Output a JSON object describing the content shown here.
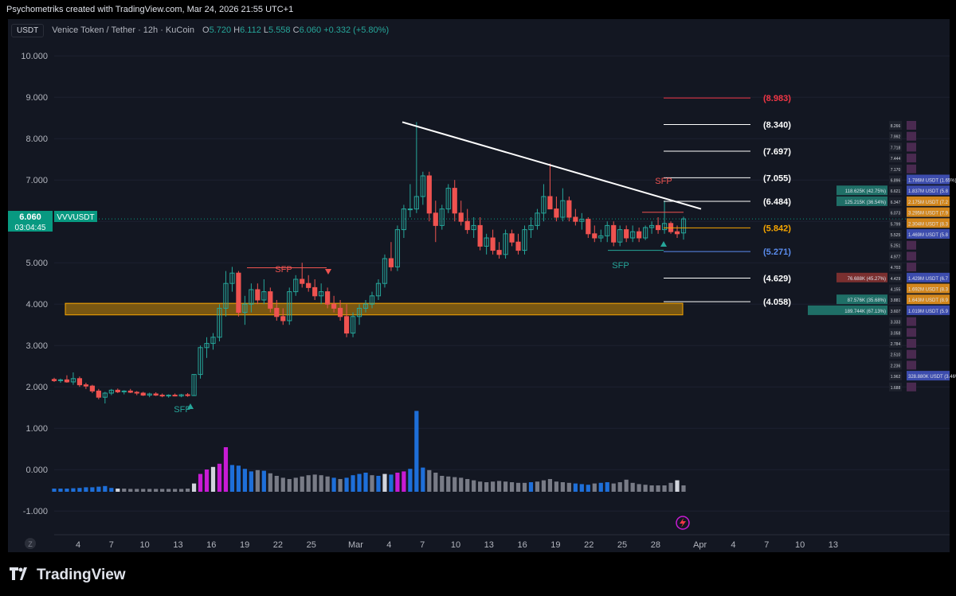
{
  "header": {
    "attribution": "Psychometriks created with TradingView.com, Mar 24, 2026 21:55 UTC+1"
  },
  "symbol": {
    "currency_button": "USDT",
    "title": "Venice Token / Tether · 12h · KuCoin",
    "o_label": "O",
    "o": "5.720",
    "h_label": "H",
    "h": "6.112",
    "l_label": "L",
    "l": "5.558",
    "c_label": "C",
    "c": "6.060",
    "change": "+0.332 (+5.80%)"
  },
  "price_tag": {
    "price": "6.060",
    "countdown": "03:04:45",
    "symbol_label": "VVVUSDT"
  },
  "footer": {
    "logo_text": "TradingView",
    "timezone_button": "Z"
  },
  "colors": {
    "up": "#26a69a",
    "down": "#ef5350",
    "accent": "#089981",
    "fib": "#ffffff",
    "fib_upper": "#f23645",
    "fib_mid": "#f7a600",
    "fib_low": "#5b8def",
    "zone": "#f7a600"
  },
  "chart_data": {
    "type": "candlestick",
    "title": "Venice Token / Tether · 12h · KuCoin",
    "ylim": [
      -1.0,
      10.0
    ],
    "y_ticks": [
      "10.000",
      "9.000",
      "8.000",
      "7.000",
      "6.000",
      "5.000",
      "4.000",
      "3.000",
      "2.000",
      "1.000",
      "0.000",
      "-1.000"
    ],
    "x_ticks": [
      {
        "label": "4",
        "day": 4
      },
      {
        "label": "7",
        "day": 7
      },
      {
        "label": "10",
        "day": 10
      },
      {
        "label": "13",
        "day": 13
      },
      {
        "label": "16",
        "day": 16
      },
      {
        "label": "19",
        "day": 19
      },
      {
        "label": "22",
        "day": 22
      },
      {
        "label": "25",
        "day": 25
      },
      {
        "label": "Mar",
        "day": 29
      },
      {
        "label": "4",
        "day": 32
      },
      {
        "label": "7",
        "day": 35
      },
      {
        "label": "10",
        "day": 38
      },
      {
        "label": "13",
        "day": 41
      },
      {
        "label": "16",
        "day": 44
      },
      {
        "label": "19",
        "day": 47
      },
      {
        "label": "22",
        "day": 50
      },
      {
        "label": "25",
        "day": 53
      },
      {
        "label": "28",
        "day": 56
      },
      {
        "label": "Apr",
        "day": 60
      },
      {
        "label": "4",
        "day": 63
      },
      {
        "label": "7",
        "day": 66
      },
      {
        "label": "10",
        "day": 69
      },
      {
        "label": "13",
        "day": 72
      }
    ],
    "candles": [
      [
        2.18,
        2.22,
        2.12,
        2.15
      ],
      [
        2.15,
        2.2,
        2.1,
        2.17
      ],
      [
        2.17,
        2.28,
        2.1,
        2.12
      ],
      [
        2.12,
        2.35,
        2.05,
        2.2
      ],
      [
        2.2,
        2.25,
        2.0,
        2.05
      ],
      [
        2.05,
        2.1,
        1.95,
        2.02
      ],
      [
        2.02,
        2.05,
        1.85,
        1.9
      ],
      [
        1.9,
        1.95,
        1.7,
        1.75
      ],
      [
        1.75,
        1.88,
        1.6,
        1.85
      ],
      [
        1.85,
        1.95,
        1.8,
        1.92
      ],
      [
        1.92,
        1.96,
        1.85,
        1.88
      ],
      [
        1.88,
        1.92,
        1.82,
        1.9
      ],
      [
        1.9,
        1.95,
        1.85,
        1.87
      ],
      [
        1.87,
        1.9,
        1.8,
        1.85
      ],
      [
        1.85,
        1.88,
        1.78,
        1.8
      ],
      [
        1.8,
        1.86,
        1.75,
        1.83
      ],
      [
        1.83,
        1.87,
        1.78,
        1.8
      ],
      [
        1.8,
        1.84,
        1.75,
        1.78
      ],
      [
        1.78,
        1.82,
        1.74,
        1.8
      ],
      [
        1.8,
        1.84,
        1.77,
        1.78
      ],
      [
        1.78,
        1.83,
        1.75,
        1.81
      ],
      [
        1.81,
        1.85,
        1.76,
        1.79
      ],
      [
        1.79,
        2.3,
        1.78,
        2.3
      ],
      [
        2.3,
        3.0,
        2.2,
        2.95
      ],
      [
        2.95,
        3.2,
        2.7,
        3.05
      ],
      [
        3.05,
        3.3,
        2.9,
        3.2
      ],
      [
        3.2,
        4.0,
        3.1,
        3.9
      ],
      [
        3.9,
        4.8,
        3.7,
        4.5
      ],
      [
        4.5,
        4.9,
        4.3,
        4.75
      ],
      [
        4.75,
        4.8,
        3.7,
        3.8
      ],
      [
        3.8,
        4.2,
        3.5,
        4.0
      ],
      [
        4.0,
        4.5,
        3.8,
        4.35
      ],
      [
        4.35,
        4.5,
        4.0,
        4.1
      ],
      [
        4.1,
        4.6,
        4.0,
        4.3
      ],
      [
        4.3,
        4.4,
        3.8,
        3.9
      ],
      [
        3.9,
        4.1,
        3.6,
        3.7
      ],
      [
        3.7,
        3.9,
        3.5,
        3.6
      ],
      [
        3.6,
        4.4,
        3.5,
        4.3
      ],
      [
        4.3,
        4.7,
        4.2,
        4.6
      ],
      [
        4.6,
        5.0,
        4.4,
        4.5
      ],
      [
        4.5,
        4.7,
        4.3,
        4.4
      ],
      [
        4.4,
        4.6,
        4.1,
        4.2
      ],
      [
        4.2,
        4.5,
        4.0,
        4.3
      ],
      [
        4.3,
        4.4,
        3.9,
        4.0
      ],
      [
        4.0,
        4.2,
        3.8,
        3.9
      ],
      [
        3.9,
        4.1,
        3.6,
        3.7
      ],
      [
        3.7,
        4.0,
        3.2,
        3.3
      ],
      [
        3.3,
        3.8,
        3.2,
        3.7
      ],
      [
        3.7,
        4.0,
        3.5,
        3.9
      ],
      [
        3.9,
        4.1,
        3.8,
        4.0
      ],
      [
        4.0,
        4.3,
        3.9,
        4.2
      ],
      [
        4.2,
        4.6,
        4.1,
        4.5
      ],
      [
        4.5,
        5.2,
        4.4,
        5.1
      ],
      [
        5.1,
        5.5,
        4.8,
        4.9
      ],
      [
        4.9,
        5.9,
        4.8,
        5.8
      ],
      [
        5.8,
        6.4,
        5.6,
        6.3
      ],
      [
        6.3,
        6.9,
        6.1,
        6.3
      ],
      [
        6.3,
        8.4,
        6.2,
        6.6
      ],
      [
        6.6,
        7.2,
        6.4,
        7.1
      ],
      [
        7.1,
        7.2,
        6.0,
        6.2
      ],
      [
        6.2,
        6.5,
        5.5,
        5.9
      ],
      [
        5.9,
        6.4,
        5.8,
        6.3
      ],
      [
        6.3,
        6.9,
        6.2,
        6.8
      ],
      [
        6.8,
        7.0,
        6.0,
        6.2
      ],
      [
        6.2,
        6.5,
        5.9,
        6.0
      ],
      [
        6.0,
        6.3,
        5.7,
        5.8
      ],
      [
        5.8,
        6.1,
        5.6,
        5.9
      ],
      [
        5.9,
        6.1,
        5.3,
        5.4
      ],
      [
        5.4,
        5.7,
        5.2,
        5.6
      ],
      [
        5.6,
        5.8,
        5.2,
        5.3
      ],
      [
        5.3,
        5.5,
        5.1,
        5.2
      ],
      [
        5.2,
        5.8,
        5.1,
        5.7
      ],
      [
        5.7,
        5.8,
        5.4,
        5.5
      ],
      [
        5.5,
        5.7,
        5.2,
        5.3
      ],
      [
        5.3,
        5.9,
        5.2,
        5.8
      ],
      [
        5.8,
        6.1,
        5.6,
        5.9
      ],
      [
        5.9,
        6.3,
        5.8,
        6.2
      ],
      [
        6.2,
        6.9,
        6.0,
        6.6
      ],
      [
        6.6,
        7.4,
        6.5,
        6.3
      ],
      [
        6.3,
        6.6,
        6.0,
        6.1
      ],
      [
        6.1,
        6.8,
        6.0,
        6.5
      ],
      [
        6.5,
        6.6,
        6.0,
        6.1
      ],
      [
        6.1,
        6.3,
        5.9,
        6.0
      ],
      [
        6.0,
        6.2,
        5.8,
        6.05
      ],
      [
        6.05,
        6.1,
        5.6,
        5.7
      ],
      [
        5.7,
        5.9,
        5.5,
        5.6
      ],
      [
        5.6,
        5.8,
        5.5,
        5.65
      ],
      [
        5.65,
        6.0,
        5.5,
        5.9
      ],
      [
        5.9,
        6.0,
        5.4,
        5.5
      ],
      [
        5.5,
        5.9,
        5.4,
        5.8
      ],
      [
        5.8,
        5.9,
        5.5,
        5.6
      ],
      [
        5.6,
        5.9,
        5.5,
        5.75
      ],
      [
        5.75,
        5.85,
        5.5,
        5.6
      ],
      [
        5.6,
        5.9,
        5.55,
        5.85
      ],
      [
        5.85,
        6.0,
        5.7,
        5.9
      ],
      [
        5.9,
        6.1,
        5.7,
        5.8
      ],
      [
        5.8,
        6.5,
        5.7,
        5.95
      ],
      [
        5.95,
        6.0,
        5.7,
        5.75
      ],
      [
        5.75,
        5.9,
        5.6,
        5.7
      ],
      [
        5.72,
        6.112,
        5.558,
        6.06
      ]
    ],
    "volume": [
      0.5,
      0.5,
      0.5,
      0.55,
      0.6,
      0.7,
      0.7,
      0.8,
      0.9,
      0.6,
      0.5,
      0.5,
      0.45,
      0.45,
      0.45,
      0.45,
      0.45,
      0.45,
      0.45,
      0.45,
      0.45,
      0.5,
      1.3,
      2.8,
      3.5,
      3.9,
      4.4,
      7.0,
      4.2,
      4.1,
      3.6,
      3.2,
      3.4,
      3.3,
      2.9,
      2.5,
      2.2,
      2.0,
      2.2,
      2.4,
      2.6,
      2.7,
      2.6,
      2.4,
      2.2,
      2.0,
      2.2,
      2.6,
      2.8,
      3.0,
      2.6,
      2.5,
      2.8,
      2.7,
      3.0,
      3.2,
      3.6,
      12.7,
      3.8,
      3.4,
      3.0,
      2.5,
      2.4,
      2.3,
      2.2,
      2.0,
      1.8,
      1.6,
      1.5,
      1.6,
      1.7,
      1.6,
      1.5,
      1.4,
      1.4,
      1.5,
      1.6,
      1.8,
      2.0,
      1.6,
      1.5,
      1.4,
      1.3,
      1.2,
      1.1,
      1.3,
      1.4,
      1.5,
      1.3,
      1.5,
      1.9,
      1.4,
      1.2,
      1.1,
      1.0,
      1.0,
      1.0,
      1.4,
      1.8,
      1.0,
      0.9
    ],
    "volume_colors": [
      "b",
      "b",
      "b",
      "b",
      "b",
      "b",
      "b",
      "b",
      "b",
      "b",
      "w",
      "g",
      "g",
      "g",
      "g",
      "g",
      "g",
      "g",
      "g",
      "g",
      "g",
      "g",
      "w",
      "m",
      "m",
      "w",
      "m",
      "m",
      "b",
      "b",
      "b",
      "b",
      "g",
      "b",
      "g",
      "g",
      "g",
      "g",
      "g",
      "g",
      "g",
      "g",
      "g",
      "g",
      "b",
      "g",
      "b",
      "b",
      "b",
      "b",
      "g",
      "b",
      "w",
      "b",
      "m",
      "m",
      "b",
      "b",
      "b",
      "g",
      "g",
      "g",
      "g",
      "g",
      "g",
      "g",
      "g",
      "g",
      "g",
      "g",
      "g",
      "g",
      "g",
      "g",
      "g",
      "b",
      "g",
      "g",
      "g",
      "g",
      "g",
      "g",
      "b",
      "b",
      "b",
      "g",
      "b",
      "b",
      "g",
      "g",
      "g",
      "g",
      "g",
      "g",
      "g",
      "g",
      "g",
      "g",
      "w",
      "g",
      "g"
    ],
    "fib_levels": [
      {
        "label": "(8.983)",
        "value": 8.983,
        "tone": "upper"
      },
      {
        "label": "(8.340)",
        "value": 8.34,
        "tone": "white"
      },
      {
        "label": "(7.697)",
        "value": 7.697,
        "tone": "white"
      },
      {
        "label": "(7.055)",
        "value": 7.055,
        "tone": "white"
      },
      {
        "label": "(6.484)",
        "value": 6.484,
        "tone": "white"
      },
      {
        "label": "(5.842)",
        "value": 5.842,
        "tone": "mid"
      },
      {
        "label": "(5.271)",
        "value": 5.271,
        "tone": "low"
      },
      {
        "label": "(4.629)",
        "value": 4.629,
        "tone": "white"
      },
      {
        "label": "(4.058)",
        "value": 4.058,
        "tone": "white"
      }
    ],
    "annotations": [
      {
        "text": "SFP",
        "color": "red",
        "at": "day18"
      },
      {
        "text": "SFP",
        "color": "green",
        "at": "day13"
      },
      {
        "text": "SFP",
        "color": "red",
        "at": "day51"
      },
      {
        "text": "SFP",
        "color": "green",
        "at": "day47"
      }
    ],
    "order_book": [
      {
        "price": "8.266",
        "left": "",
        "right": ""
      },
      {
        "price": "7.992",
        "left": "",
        "right": ""
      },
      {
        "price": "7.718",
        "left": "",
        "right": ""
      },
      {
        "price": "7.444",
        "left": "",
        "right": ""
      },
      {
        "price": "7.170",
        "left": "",
        "right": ""
      },
      {
        "price": "6.896",
        "left": "",
        "right": "1.786M USDT (1.65%)"
      },
      {
        "price": "6.621",
        "left": "118.625K (42.75%)",
        "right": "1.837M USDT (5.8"
      },
      {
        "price": "6.347",
        "left": "125.215K (36.54%)",
        "right": "2.175M USDT (7.2"
      },
      {
        "price": "6.073",
        "left": "",
        "right": "3.295M USDT (7.9"
      },
      {
        "price": "5.799",
        "left": "",
        "right": "2.304M USDT (8.3"
      },
      {
        "price": "5.525",
        "left": "",
        "right": "1.469M USDT (5.8"
      },
      {
        "price": "5.251",
        "left": "",
        "right": ""
      },
      {
        "price": "4.977",
        "left": "",
        "right": ""
      },
      {
        "price": "4.703",
        "left": "",
        "right": ""
      },
      {
        "price": "4.429",
        "left": "76.688K (45.27%)",
        "right": "1.429M USDT (6.7"
      },
      {
        "price": "4.155",
        "left": "",
        "right": "1.692M USDT (8.3"
      },
      {
        "price": "3.881",
        "left": "87.576K (35.68%)",
        "right": "1.643M USDT (8.9"
      },
      {
        "price": "3.607",
        "left": "189.744K (67.13%)",
        "right": "1.019M USDT (5.9"
      },
      {
        "price": "3.333",
        "left": "",
        "right": ""
      },
      {
        "price": "3.058",
        "left": "",
        "right": ""
      },
      {
        "price": "2.784",
        "left": "",
        "right": ""
      },
      {
        "price": "2.510",
        "left": "",
        "right": ""
      },
      {
        "price": "2.236",
        "left": "",
        "right": ""
      },
      {
        "price": "1.962",
        "left": "",
        "right": "328.880K USDT (3.46%)"
      },
      {
        "price": "1.688",
        "left": "",
        "right": ""
      }
    ]
  }
}
